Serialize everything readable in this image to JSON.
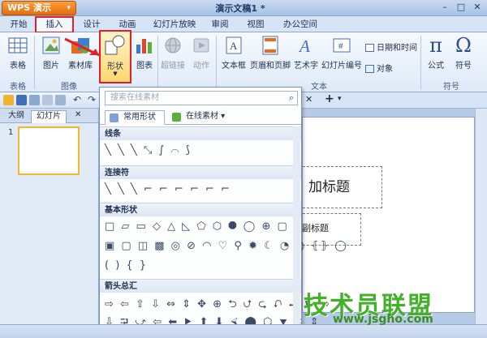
{
  "app": {
    "name": "WPS 演示",
    "doc_title": "演示文稿1 *"
  },
  "tabs": [
    {
      "label": "开始"
    },
    {
      "label": "插入"
    },
    {
      "label": "设计"
    },
    {
      "label": "动画"
    },
    {
      "label": "幻灯片放映"
    },
    {
      "label": "审阅"
    },
    {
      "label": "视图"
    },
    {
      "label": "办公空间"
    }
  ],
  "ribbon": {
    "table": "表格",
    "picture": "图片",
    "material": "素材库",
    "shape": "形状",
    "chart": "图表",
    "hyperlink": "超链接",
    "action": "动作",
    "textbox": "文本框",
    "header_footer": "页眉和页脚",
    "wordart": "艺术字",
    "slide_number": "幻灯片编号",
    "datetime": "日期和时间",
    "object": "对象",
    "formula": "公式",
    "symbol": "符号",
    "group_table": "表格",
    "group_image": "图像",
    "group_text": "文本",
    "group_symbol": "符号"
  },
  "panel": {
    "tab_outline": "大纲",
    "tab_slides": "幻灯片",
    "slide_num": "1"
  },
  "dropdown": {
    "search_placeholder": "搜索在线素材",
    "tab_common": "常用形状",
    "tab_online": "在线素材",
    "sections": [
      {
        "title": "线条",
        "shapes": "╲ ╲ ╲ ⤡ ∫ ⌒ ⟆"
      },
      {
        "title": "连接符",
        "shapes": "╲ ╲ ╲ ⌐ ⌐ ⌐ ⌐ ⌐ ⌐"
      },
      {
        "title": "基本形状",
        "shapes": "□ ▱ ▭ ◇ △ ◺ ⬠ ⬡ ⯃ ◯ ⊕ ▢",
        "shapes2": "▣ ▢ ◫ ▩ ◎ ⊘ ◠ ♡ ⚲ ✹ ☾ ◔ ⦅⦆ ⦃⦄ ◯",
        "shapes3": "(  ) { }"
      },
      {
        "title": "箭头总汇",
        "shapes": "⇨ ⇦ ⇧ ⇩ ⇔ ⇕ ✥ ⊕ ⮌ ⮍ ⮎ ⮏ ⮐ ⮑ ⇨",
        "shapes2": "⇩ ⮒ ⤻ ⇦ ⬅ ⯈ ⬆ ⬇ ⮘ ⬤ ⬡ ⯆ ⬍ ⇕"
      }
    ]
  },
  "slide": {
    "title_placeholder": "加标题",
    "subtitle_placeholder": "副标题"
  },
  "watermark": {
    "text": "技术员联盟",
    "url": "www.jsgho.com"
  },
  "colors": {
    "accent_red": "#e3202a",
    "app_orange": "#e46c0a",
    "watermark_green": "#43b02a"
  }
}
